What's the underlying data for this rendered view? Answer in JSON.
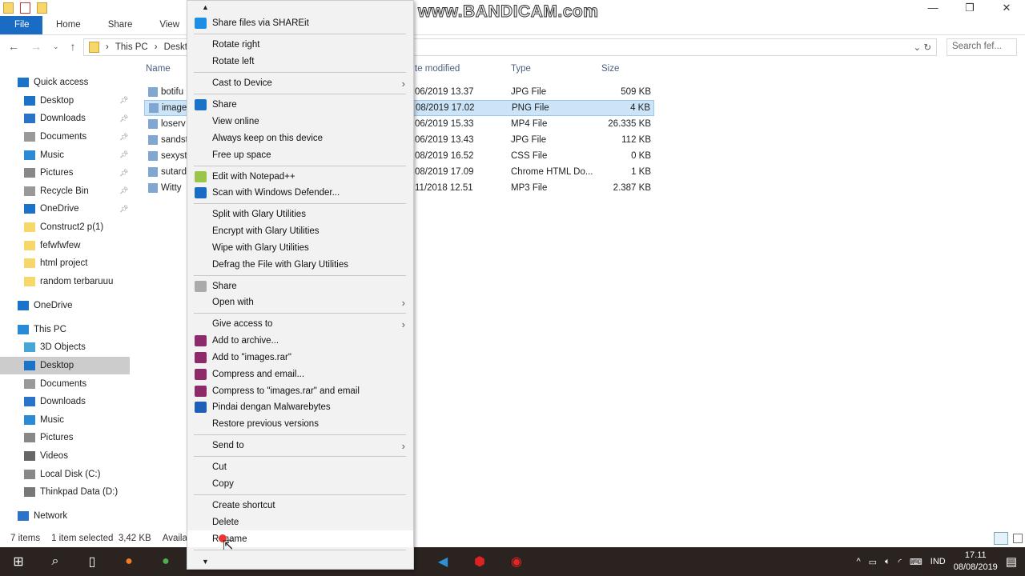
{
  "ribbon": {
    "tabs": [
      "File",
      "Home",
      "Share",
      "View"
    ]
  },
  "address": {
    "path": [
      "This PC",
      "Desktop"
    ],
    "search_placeholder": "Search fef..."
  },
  "watermark": "www.BANDICAM.com",
  "sidebar": {
    "items": [
      {
        "label": "Quick access",
        "top": true,
        "color": "#1a73c9"
      },
      {
        "label": "Desktop",
        "pin": true,
        "color": "#1a73c9"
      },
      {
        "label": "Downloads",
        "pin": true,
        "color": "#2b73c9"
      },
      {
        "label": "Documents",
        "pin": true,
        "color": "#999"
      },
      {
        "label": "Music",
        "pin": true,
        "color": "#2b8ad6"
      },
      {
        "label": "Pictures",
        "pin": true,
        "color": "#888"
      },
      {
        "label": "Recycle Bin",
        "pin": true,
        "color": "#999"
      },
      {
        "label": "OneDrive",
        "pin": true,
        "color": "#1a73c9"
      },
      {
        "label": "Construct2 p(1)",
        "color": "#f7d66a"
      },
      {
        "label": "fefwfwfew",
        "color": "#f7d66a"
      },
      {
        "label": "html project",
        "color": "#f7d66a"
      },
      {
        "label": "random terbaruuu",
        "color": "#f7d66a"
      },
      {
        "gap": true
      },
      {
        "label": "OneDrive",
        "top": true,
        "color": "#1a73c9"
      },
      {
        "gap": true
      },
      {
        "label": "This PC",
        "top": true,
        "color": "#2b8ad6"
      },
      {
        "label": "3D Objects",
        "color": "#46a6d8"
      },
      {
        "label": "Desktop",
        "sel": true,
        "color": "#1a73c9"
      },
      {
        "label": "Documents",
        "color": "#999"
      },
      {
        "label": "Downloads",
        "color": "#2b73c9"
      },
      {
        "label": "Music",
        "color": "#2b8ad6"
      },
      {
        "label": "Pictures",
        "color": "#888"
      },
      {
        "label": "Videos",
        "color": "#666"
      },
      {
        "label": "Local Disk (C:)",
        "color": "#888"
      },
      {
        "label": "Thinkpad Data (D:)",
        "color": "#777"
      },
      {
        "gap": true
      },
      {
        "label": "Network",
        "top": true,
        "color": "#2b73c9"
      }
    ]
  },
  "columns": {
    "name": "Name",
    "date": "te modified",
    "type": "Type",
    "size": "Size"
  },
  "files": [
    {
      "name": "botifu",
      "date": "06/2019 13.37",
      "type": "JPG File",
      "size": "509 KB"
    },
    {
      "name": "image",
      "date": "08/2019 17.02",
      "type": "PNG File",
      "size": "4 KB",
      "sel": true
    },
    {
      "name": "loserv",
      "date": "06/2019 15.33",
      "type": "MP4 File",
      "size": "26.335 KB"
    },
    {
      "name": "sandst",
      "date": "06/2019 13.43",
      "type": "JPG File",
      "size": "112 KB"
    },
    {
      "name": "sexyst",
      "date": "08/2019 16.52",
      "type": "CSS File",
      "size": "0 KB"
    },
    {
      "name": "sutard",
      "date": "08/2019 17.09",
      "type": "Chrome HTML Do...",
      "size": "1 KB"
    },
    {
      "name": "Witty",
      "date": "11/2018 12.51",
      "type": "MP3 File",
      "size": "2.387 KB"
    }
  ],
  "status": {
    "count": "7 items",
    "selected": "1 item selected  3,42 KB",
    "avail": "Availa"
  },
  "menu": [
    {
      "label": "Share files via SHAREit",
      "icon": "#1c8ee6"
    },
    {
      "sep": true
    },
    {
      "label": "Rotate right"
    },
    {
      "label": "Rotate left"
    },
    {
      "sep": true
    },
    {
      "label": "Cast to Device",
      "sub": true
    },
    {
      "sep": true
    },
    {
      "label": "Share",
      "icon": "#1a73c9"
    },
    {
      "label": "View online"
    },
    {
      "label": "Always keep on this device"
    },
    {
      "label": "Free up space"
    },
    {
      "sep": true
    },
    {
      "label": "Edit with Notepad++",
      "icon": "#9bc44a"
    },
    {
      "label": "Scan with Windows Defender...",
      "icon": "#1a6bc4"
    },
    {
      "sep": true
    },
    {
      "label": "Split with Glary Utilities"
    },
    {
      "label": "Encrypt with Glary Utilities"
    },
    {
      "label": "Wipe with Glary Utilities"
    },
    {
      "label": "Defrag the File with Glary Utilities"
    },
    {
      "sep": true
    },
    {
      "label": "Share",
      "icon": "#aaa"
    },
    {
      "label": "Open with",
      "sub": true
    },
    {
      "sep": true
    },
    {
      "label": "Give access to",
      "sub": true
    },
    {
      "label": "Add to archive...",
      "icon": "#8e2a6a"
    },
    {
      "label": "Add to \"images.rar\"",
      "icon": "#8e2a6a"
    },
    {
      "label": "Compress and email...",
      "icon": "#8e2a6a"
    },
    {
      "label": "Compress to \"images.rar\" and email",
      "icon": "#8e2a6a"
    },
    {
      "label": "Pindai dengan Malwarebytes",
      "icon": "#1d5fb8"
    },
    {
      "label": "Restore previous versions"
    },
    {
      "sep": true
    },
    {
      "label": "Send to",
      "sub": true
    },
    {
      "sep": true
    },
    {
      "label": "Cut"
    },
    {
      "label": "Copy"
    },
    {
      "sep": true
    },
    {
      "label": "Create shortcut"
    },
    {
      "label": "Delete"
    },
    {
      "label": "Rename",
      "hl": true
    },
    {
      "sep": true
    }
  ],
  "tray": {
    "lang": "IND",
    "time": "17.11",
    "date": "08/08/2019"
  }
}
